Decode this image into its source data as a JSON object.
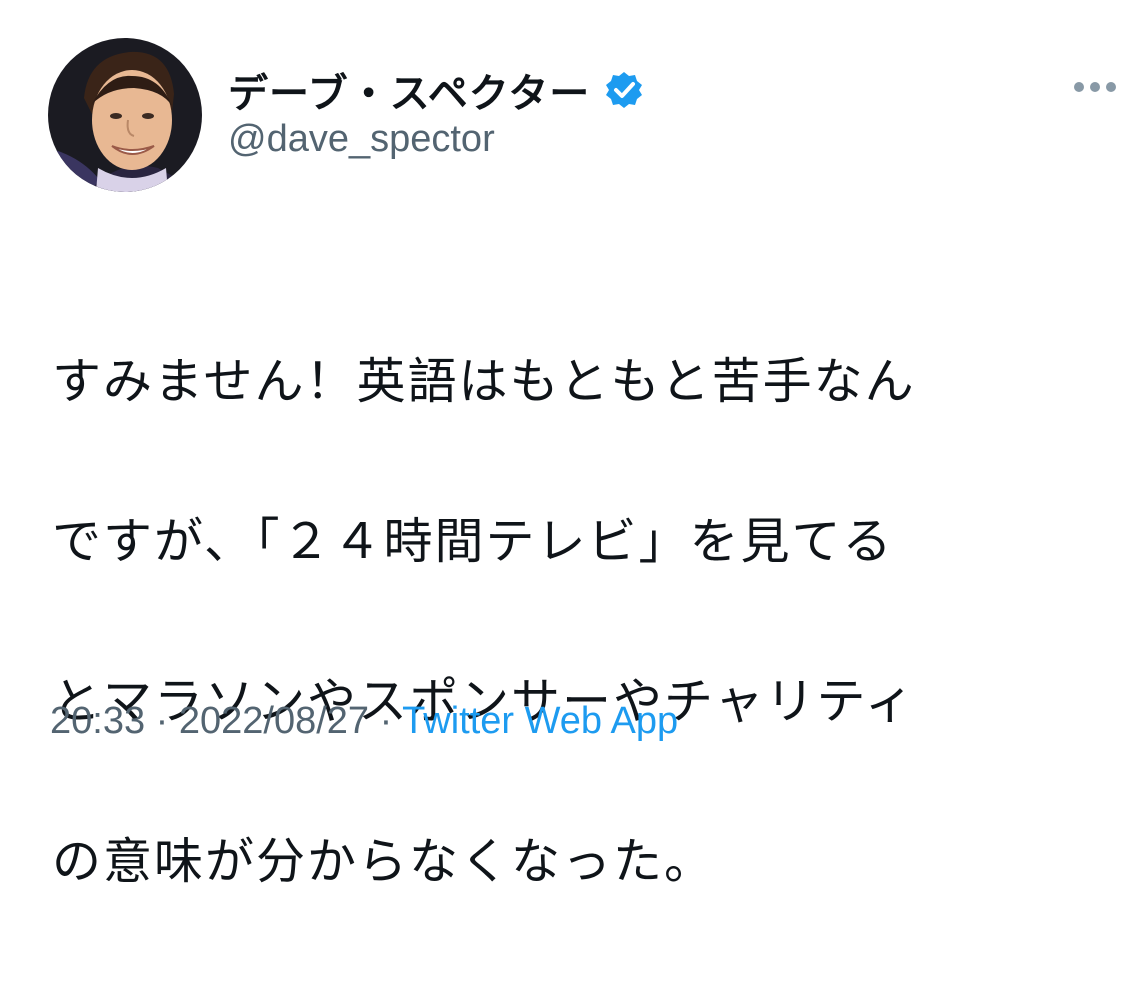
{
  "tweet": {
    "author": {
      "display_name": "デーブ・スペクター",
      "handle": "@dave_spector",
      "verified": true,
      "avatar_icon": "profile-photo"
    },
    "more_icon": "more-dots-icon",
    "text_lines": [
      "すみません！英語はもともと苦手なん",
      "ですが、「２４時間テレビ」を見てる",
      "とマラソンやスポンサーやチャリティ",
      "の意味が分からなくなった。"
    ],
    "time": "20:33",
    "separator": "·",
    "date": "2022/08/27",
    "source": "Twitter Web App"
  },
  "colors": {
    "text": "#0f1419",
    "secondary": "#536471",
    "link": "#1d9bf0",
    "verified_badge": "#1d9bf0"
  }
}
